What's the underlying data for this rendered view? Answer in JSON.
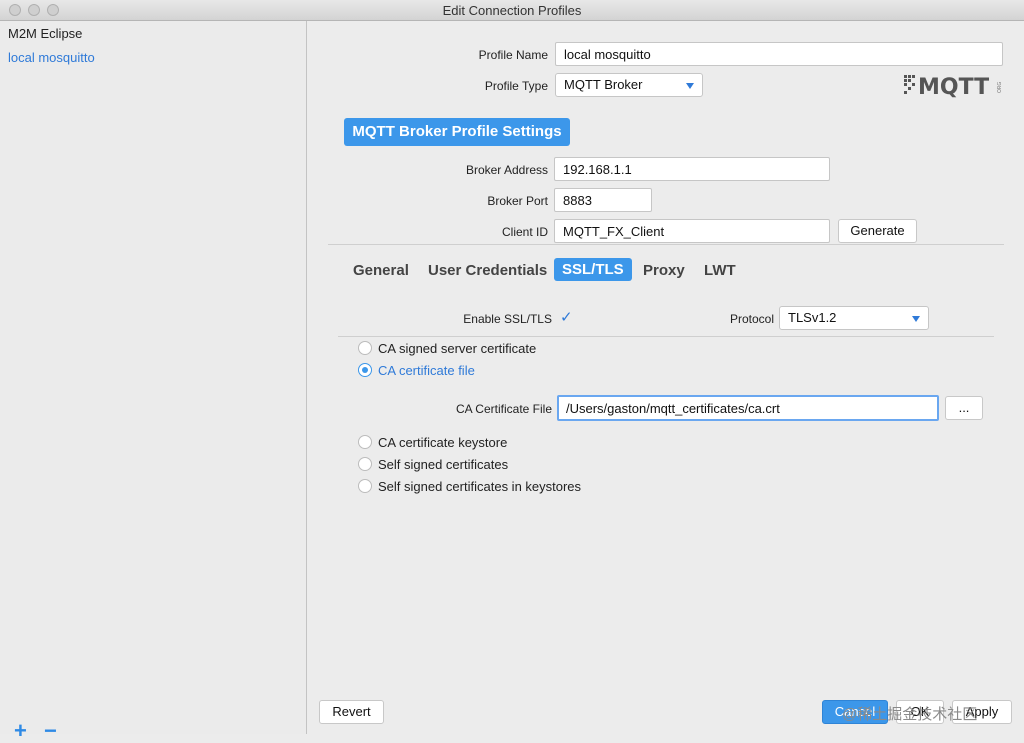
{
  "window": {
    "title": "Edit Connection Profiles"
  },
  "sidebar": {
    "items": [
      {
        "label": "M2M Eclipse"
      },
      {
        "label": "local mosquitto"
      }
    ],
    "add_icon": "plus-icon",
    "remove_icon": "minus-icon"
  },
  "profile": {
    "name_label": "Profile Name",
    "name_value": "local mosquitto",
    "type_label": "Profile Type",
    "type_value": "MQTT Broker",
    "logo_text": "MQTT",
    "logo_sub": "ORG"
  },
  "section_title": "MQTT Broker Profile Settings",
  "broker": {
    "address_label": "Broker Address",
    "address_value": "192.168.1.1",
    "port_label": "Broker Port",
    "port_value": "8883",
    "client_id_label": "Client ID",
    "client_id_value": "MQTT_FX_Client",
    "generate_label": "Generate"
  },
  "tabs": [
    {
      "label": "General"
    },
    {
      "label": "User Credentials"
    },
    {
      "label": "SSL/TLS"
    },
    {
      "label": "Proxy"
    },
    {
      "label": "LWT"
    }
  ],
  "ssl": {
    "enable_label": "Enable SSL/TLS",
    "enabled": true,
    "protocol_label": "Protocol",
    "protocol_value": "TLSv1.2",
    "options": [
      {
        "label": "CA signed server certificate"
      },
      {
        "label": "CA certificate file"
      },
      {
        "label": "CA certificate keystore"
      },
      {
        "label": "Self signed certificates"
      },
      {
        "label": "Self signed certificates in keystores"
      }
    ],
    "selected": "CA certificate file",
    "ca_file_label": "CA Certificate File",
    "ca_file_value": "/Users/gaston/mqtt_certificates/ca.crt",
    "browse_label": "..."
  },
  "footer": {
    "revert_label": "Revert",
    "cancel_label": "Cancel",
    "ok_label": "OK",
    "apply_label": "Apply"
  },
  "watermark": "@稀土掘金技术社区",
  "colors": {
    "accent": "#3c97ea",
    "selected_text": "#2f7ad8"
  }
}
